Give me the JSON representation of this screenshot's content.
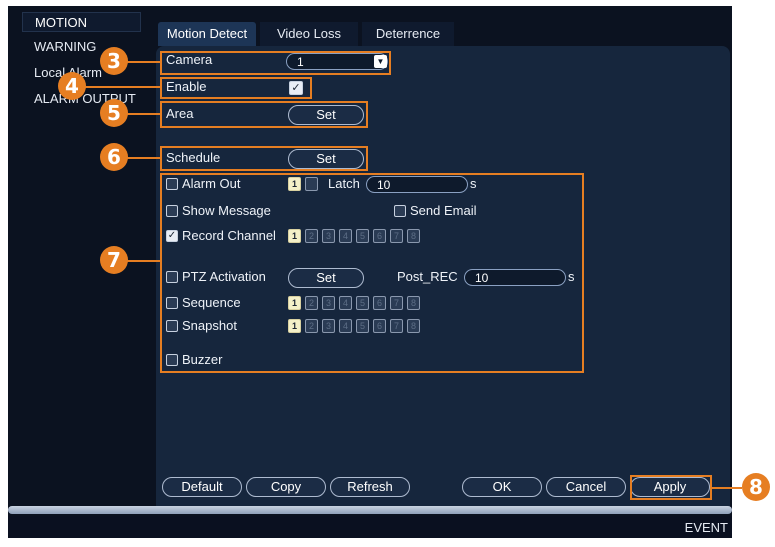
{
  "sidebar": {
    "items": [
      {
        "label": "MOTION",
        "active": true
      },
      {
        "label": "WARNING",
        "active": false
      },
      {
        "label": "Local Alarm",
        "active": false
      },
      {
        "label": "ALARM OUTPUT",
        "active": false
      }
    ]
  },
  "tabs": [
    {
      "label": "Motion Detect",
      "active": true
    },
    {
      "label": "Video Loss",
      "active": false
    },
    {
      "label": "Deterrence",
      "active": false
    }
  ],
  "form": {
    "camera_label": "Camera",
    "camera_value": "1",
    "enable_label": "Enable",
    "enable_checked": true,
    "area_label": "Area",
    "area_button": "Set",
    "schedule_label": "Schedule",
    "schedule_button": "Set",
    "alarm_out_label": "Alarm Out",
    "alarm_out_channels": [
      "1",
      ""
    ],
    "latch_label": "Latch",
    "latch_value": "10",
    "latch_unit": "s",
    "show_message_label": "Show Message",
    "send_email_label": "Send Email",
    "record_channel_label": "Record Channel",
    "record_channel_checked": true,
    "channels": [
      "1",
      "2",
      "3",
      "4",
      "5",
      "6",
      "7",
      "8"
    ],
    "ptz_label": "PTZ Activation",
    "ptz_button": "Set",
    "post_rec_label": "Post_REC",
    "post_rec_value": "10",
    "post_rec_unit": "s",
    "sequence_label": "Sequence",
    "snapshot_label": "Snapshot",
    "buzzer_label": "Buzzer"
  },
  "footer": {
    "default": "Default",
    "copy": "Copy",
    "refresh": "Refresh",
    "ok": "OK",
    "cancel": "Cancel",
    "apply": "Apply"
  },
  "status_bar": {
    "label": "EVENT"
  },
  "callouts": [
    "3",
    "4",
    "5",
    "6",
    "7",
    "8"
  ],
  "colors": {
    "accent": "#e67e22",
    "panel": "#16263d",
    "background": "#0b1220"
  }
}
